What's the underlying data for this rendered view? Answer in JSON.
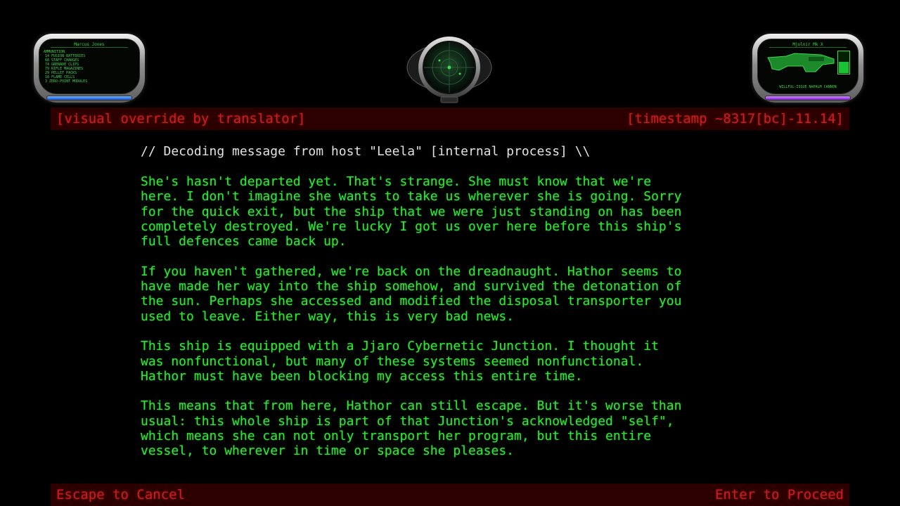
{
  "hud": {
    "left_panel": {
      "title": "Marcus Jones",
      "section": "AMMUNITION",
      "items": [
        "14 FUSION BATTERIES",
        "68 STAFF CHARGES",
        "74 GRENADE CLIPS",
        "79 RIFLE MAGAZINES",
        "29 PELLET PACKS",
        "18 FLAME CELLS",
        "3 ZERO-POINT MODULES"
      ],
      "bar_color": "#2a6cff"
    },
    "right_panel": {
      "title": "Mjolnir Mk X",
      "weapon": "WILLFUL-ISSUE NAPALM CANNON",
      "meter_level": 0.5,
      "bar_color": "#9b3dff"
    },
    "center_icon": "radar-icon"
  },
  "header": {
    "left": "[visual override by translator]",
    "right": "[timestamp ~8317[bc]-11.14]"
  },
  "message": {
    "header": "// Decoding message from host \"Leela\" [internal process] \\\\",
    "paragraphs": [
      "She's hasn't departed yet. That's strange. She must know that we're\nhere. I don't imagine she wants to take us wherever she is going. Sorry\nfor the quick exit, but the ship that we were just standing on has been\ncompletely destroyed. We're lucky I got us over here before this ship's\nfull defences came back up.",
      "If you haven't gathered, we're back on the dreadnaught. Hathor seems to\nhave made her way into the ship somehow, and survived the detonation of\nthe sun. Perhaps she accessed and modified the disposal transporter you\nused to leave. Either way, this is very bad news.",
      "This ship is equipped with a Jjaro Cybernetic Junction. I thought it\nwas nonfunctional, but many of these systems seemed nonfunctional.\nHathor must have been blocking my access this entire time.",
      "This means that from here, Hathor can still escape. But it's worse than\nusual: this whole ship is part of that Junction's acknowledged \"self\",\nwhich means she can not only transport her program, but this entire\nvessel, to wherever in time or space she pleases."
    ]
  },
  "footer": {
    "cancel": "Escape to Cancel",
    "proceed": "Enter to Proceed"
  },
  "colors": {
    "text_green": "#35e23c",
    "header_white": "#e2e2e2",
    "bar_red_bg": "#2d0000",
    "bar_red_text": "#c42020"
  }
}
